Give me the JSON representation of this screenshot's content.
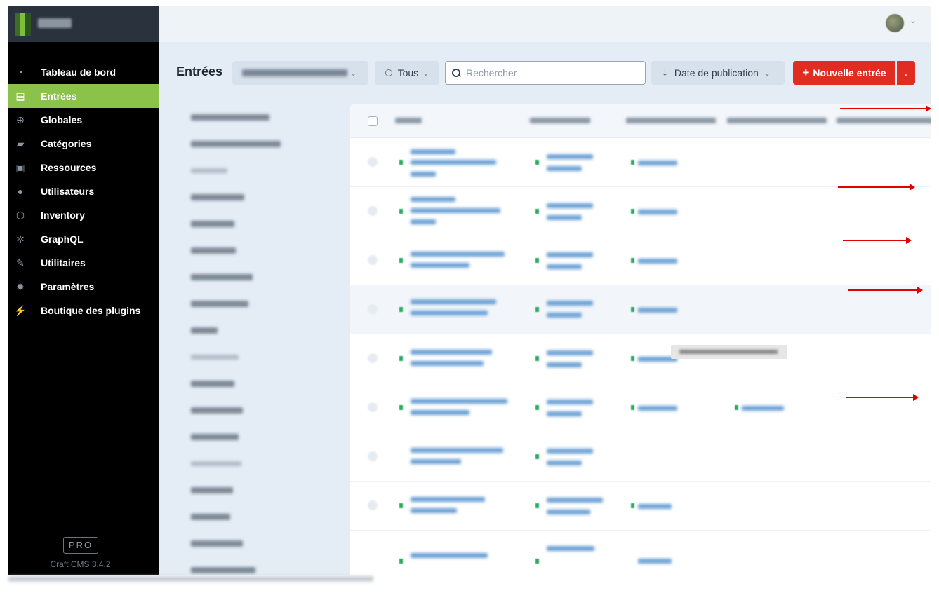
{
  "sidebar": {
    "items": [
      {
        "label": "Tableau de bord",
        "icon": "dashboard-icon",
        "glyph": "◔",
        "active": false
      },
      {
        "label": "Entrées",
        "icon": "entries-icon",
        "glyph": "▤",
        "active": true
      },
      {
        "label": "Globales",
        "icon": "globe-icon",
        "glyph": "⊕",
        "active": false
      },
      {
        "label": "Catégories",
        "icon": "folder-icon",
        "glyph": "▰",
        "active": false
      },
      {
        "label": "Ressources",
        "icon": "image-icon",
        "glyph": "▣",
        "active": false
      },
      {
        "label": "Utilisateurs",
        "icon": "users-icon",
        "glyph": "●",
        "active": false
      },
      {
        "label": "Inventory",
        "icon": "cube-icon",
        "glyph": "⬡",
        "active": false
      },
      {
        "label": "GraphQL",
        "icon": "graphql-icon",
        "glyph": "✲",
        "active": false
      },
      {
        "label": "Utilitaires",
        "icon": "wrench-icon",
        "glyph": "✎",
        "active": false
      },
      {
        "label": "Paramètres",
        "icon": "gear-icon",
        "glyph": "✹",
        "active": false
      },
      {
        "label": "Boutique des plugins",
        "icon": "plug-icon",
        "glyph": "⚡",
        "active": false
      }
    ],
    "pro_badge": "PRO",
    "version": "Craft CMS 3.4.2"
  },
  "toolbar": {
    "title": "Entrées",
    "status_label": "Tous",
    "search_placeholder": "Rechercher",
    "sort_label": "Date de publication",
    "new_entry_label": "Nouvelle entrée",
    "new_entry_plus": "+"
  },
  "colors": {
    "accent_green": "#8bc34a",
    "primary_red": "#e12d21",
    "status_green": "#27ae60",
    "annotation_red": "#e00000"
  }
}
